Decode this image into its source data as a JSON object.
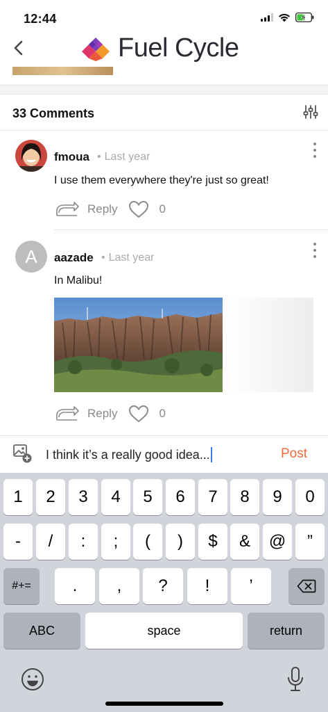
{
  "status_bar": {
    "time": "12:44"
  },
  "header": {
    "logo_text": "Fuel Cycle",
    "back_icon": "chevron-left-icon"
  },
  "comments_section": {
    "title": "33 Comments",
    "filter_icon": "sliders-icon"
  },
  "comments": [
    {
      "username": "fmoua",
      "time": "Last year",
      "text": "I use them everywhere they're just so great!",
      "reply_label": "Reply",
      "likes": "0",
      "avatar_type": "photo"
    },
    {
      "username": "aazade",
      "avatar_letter": "A",
      "time": "Last year",
      "text": "In Malibu!",
      "reply_label": "Reply",
      "likes": "0",
      "avatar_type": "letter",
      "has_photo": true
    }
  ],
  "composer": {
    "text": "I think it’s a really good idea...",
    "post_label": "Post",
    "attach_icon": "add-image-icon"
  },
  "keyboard": {
    "row1": [
      "1",
      "2",
      "3",
      "4",
      "5",
      "6",
      "7",
      "8",
      "9",
      "0"
    ],
    "row2": [
      "-",
      "/",
      ":",
      ";",
      "(",
      ")",
      "$",
      "&",
      "@",
      "”"
    ],
    "row3": [
      ".",
      ",",
      "?",
      "!",
      "’"
    ],
    "symbols_key": "#+=",
    "abc_key": "ABC",
    "space_key": "space",
    "return_key": "return"
  },
  "colors": {
    "accent": "#f26b3a",
    "keyboard_bg": "#d1d4da",
    "muted": "#8a8a8a"
  }
}
